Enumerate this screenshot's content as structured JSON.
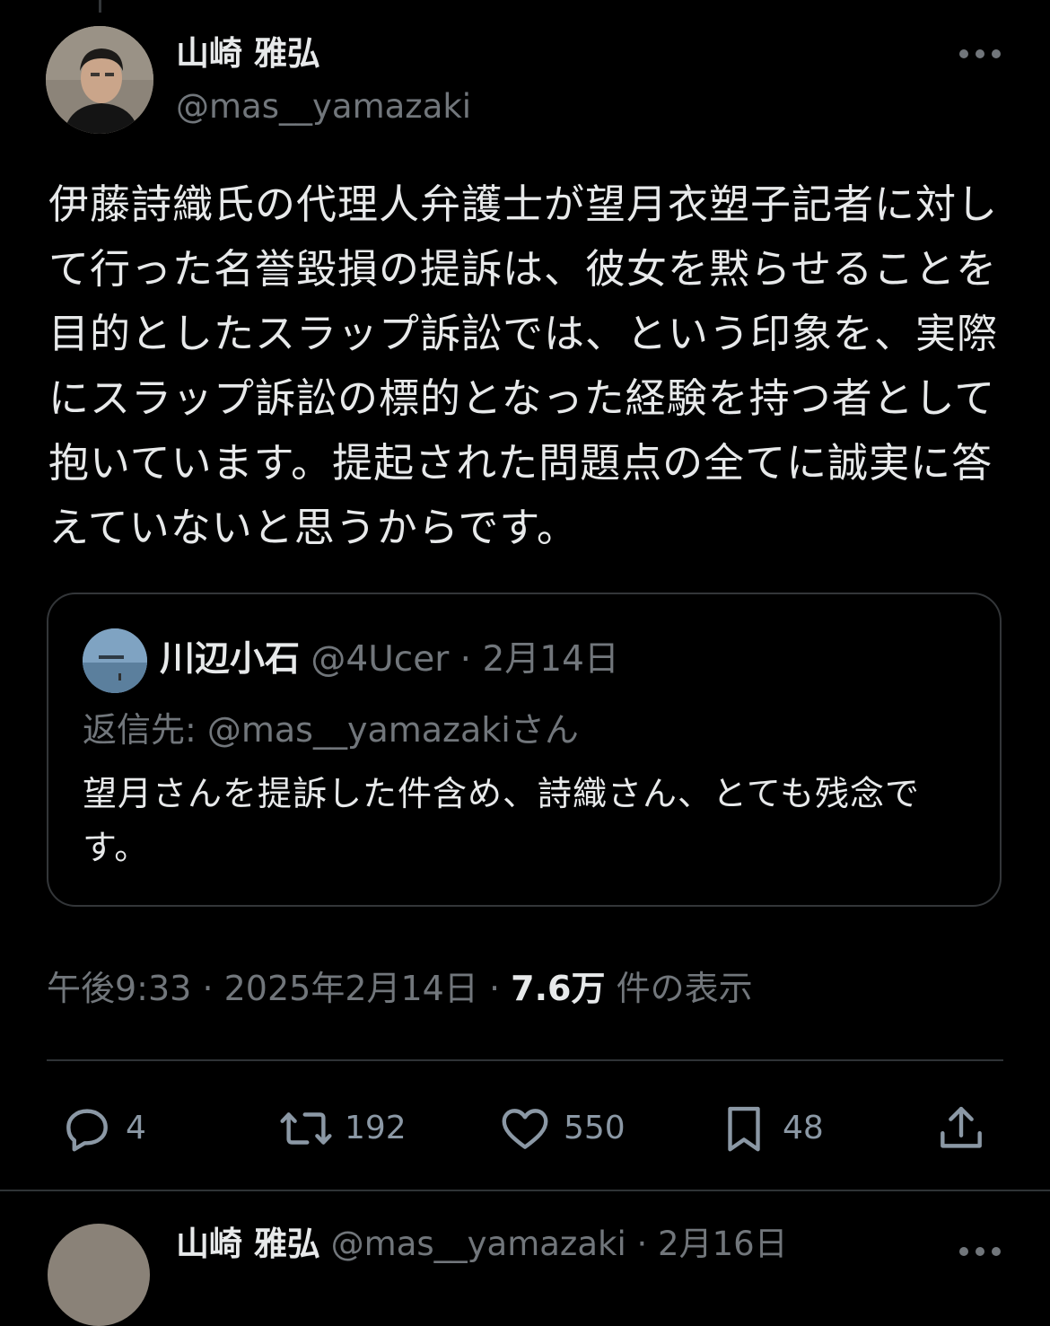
{
  "tweet": {
    "author_name": "山崎 雅弘",
    "author_handle": "@mas__yamazaki",
    "text": "伊藤詩織氏の代理人弁護士が望月衣塑子記者に対して行った名誉毀損の提訴は、彼女を黙らせることを目的としたスラップ訴訟では、という印象を、実際にスラップ訴訟の標的となった経験を持つ者として抱いています。提起された問題点の全てに誠実に答えていないと思うからです。",
    "quote": {
      "author_name": "川辺小石",
      "author_handle": "@4Ucer",
      "separator": "·",
      "date": "2月14日",
      "reply_to": "返信先: @mas__yamazakiさん",
      "text": "望月さんを提訴した件含め、詩織さん、とても残念です。"
    },
    "meta": {
      "time": "午後9:33",
      "separator": "·",
      "date": "2025年2月14日",
      "separator2": "·",
      "views_count": "7.6万",
      "views_label": "件の表示"
    },
    "actions": {
      "reply": {
        "icon": "reply-icon",
        "count": "4"
      },
      "retweet": {
        "icon": "retweet-icon",
        "count": "192"
      },
      "like": {
        "icon": "heart-icon",
        "count": "550"
      },
      "bookmark": {
        "icon": "bookmark-icon",
        "count": "48"
      },
      "share": {
        "icon": "share-icon"
      }
    },
    "more_icon": "more-dots-icon"
  },
  "next_tweet": {
    "author_name": "山崎 雅弘",
    "author_handle": "@mas__yamazaki",
    "separator": "·",
    "date": "2月16日"
  },
  "colors": {
    "background": "#000000",
    "text_primary": "#e7e9ea",
    "text_secondary": "#71767b",
    "border": "#333639"
  }
}
